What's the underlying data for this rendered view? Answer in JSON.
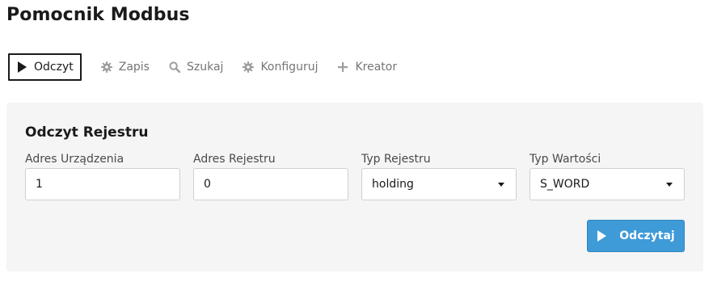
{
  "page": {
    "title": "Pomocnik Modbus"
  },
  "tabs": [
    {
      "label": "Odczyt",
      "icon": "play-icon",
      "active": true
    },
    {
      "label": "Zapis",
      "icon": "gear-icon",
      "active": false
    },
    {
      "label": "Szukaj",
      "icon": "search-icon",
      "active": false
    },
    {
      "label": "Konfiguruj",
      "icon": "gear-icon",
      "active": false
    },
    {
      "label": "Kreator",
      "icon": "plus-icon",
      "active": false
    }
  ],
  "form": {
    "title": "Odczyt Rejestru",
    "device_address": {
      "label": "Adres Urządzenia",
      "value": "1"
    },
    "register_address": {
      "label": "Adres Rejestru",
      "value": "0"
    },
    "register_type": {
      "label": "Typ Rejestru",
      "selected": "holding"
    },
    "value_type": {
      "label": "Typ Wartości",
      "selected": "S_WORD"
    },
    "submit_label": "Odczytaj"
  },
  "colors": {
    "accent": "#3f9ad8",
    "panel_bg": "#f5f5f5",
    "inactive_tab": "#757575"
  }
}
